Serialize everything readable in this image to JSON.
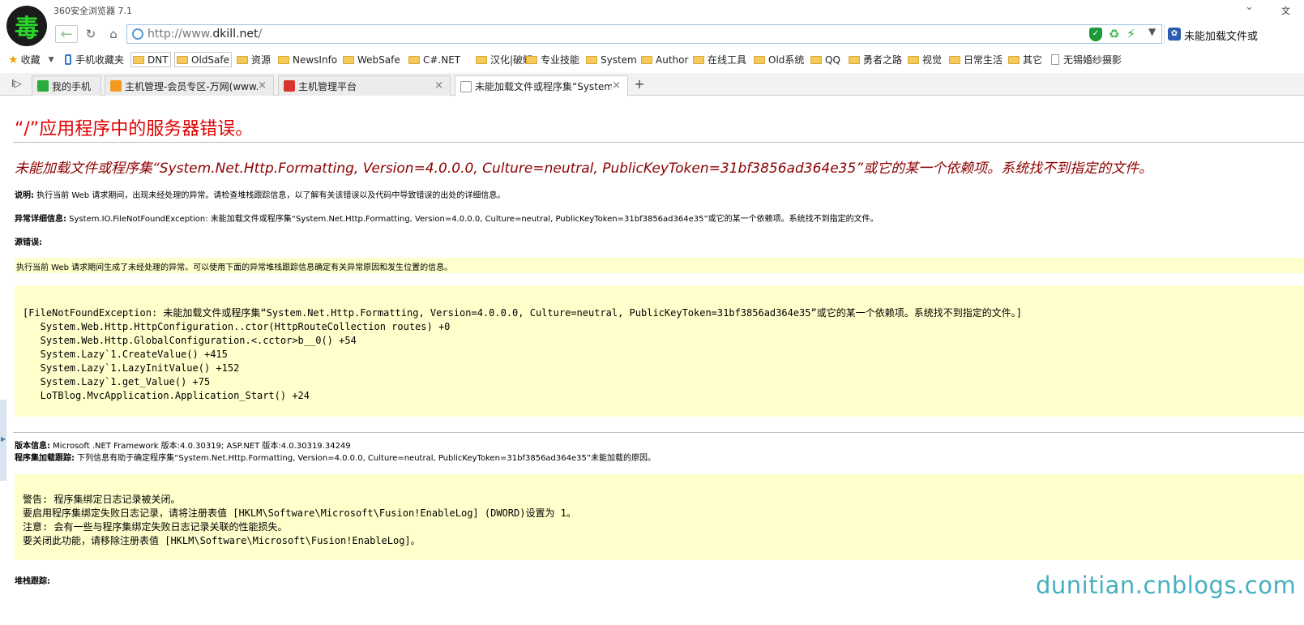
{
  "window": {
    "app_title": "360安全浏览器 7.1",
    "right_text": "文",
    "logo_char": "毒"
  },
  "addressbar": {
    "url_prefix": "http://www.",
    "url_domain": "dkill.net",
    "url_suffix": "/",
    "search_text": "未能加载文件或"
  },
  "bookmarks": [
    {
      "label": "收藏",
      "icon": "star-icon"
    },
    {
      "label": "手机收藏夹",
      "icon": "phone-icon"
    },
    {
      "label": "DNT",
      "icon": "folder-icon"
    },
    {
      "label": "OldSafe",
      "icon": "folder-icon"
    },
    {
      "label": "资源",
      "icon": "folder-icon"
    },
    {
      "label": "NewsInfo",
      "icon": "folder-icon"
    },
    {
      "label": "WebSafe",
      "icon": "folder-icon"
    },
    {
      "label": "C#.NET",
      "icon": "folder-icon"
    },
    {
      "label": "汉化|破解",
      "icon": "folder-icon"
    },
    {
      "label": "专业技能",
      "icon": "folder-icon"
    },
    {
      "label": "System",
      "icon": "folder-icon"
    },
    {
      "label": "Author",
      "icon": "folder-icon"
    },
    {
      "label": "在线工具",
      "icon": "folder-icon"
    },
    {
      "label": "Old系统",
      "icon": "folder-icon"
    },
    {
      "label": "QQ",
      "icon": "folder-icon"
    },
    {
      "label": "勇者之路",
      "icon": "folder-icon"
    },
    {
      "label": "视觉",
      "icon": "folder-icon"
    },
    {
      "label": "日常生活",
      "icon": "folder-icon"
    },
    {
      "label": "其它",
      "icon": "folder-icon"
    },
    {
      "label": "无锡婚纱摄影",
      "icon": "page-icon"
    }
  ],
  "tabs": [
    {
      "label": "我的手机",
      "color": "#2bab3a"
    },
    {
      "label": "主机管理-会员专区-万网(www.",
      "color": "#f39a1e"
    },
    {
      "label": "主机管理平台",
      "color": "#d9342b"
    },
    {
      "label": "未能加载文件或程序集“System",
      "color": "#ffffff"
    }
  ],
  "page": {
    "title": "“/”应用程序中的服务器错误。",
    "subtitle": "未能加载文件或程序集“System.Net.Http.Formatting, Version=4.0.0.0, Culture=neutral, PublicKeyToken=31bf3856ad364e35”或它的某一个依赖项。系统找不到指定的文件。",
    "desc_label": "说明:",
    "desc_text": " 执行当前 Web 请求期间，出现未经处理的异常。请检查堆栈跟踪信息，以了解有关该错误以及代码中导致错误的出处的详细信息。",
    "exception_label": "异常详细信息:",
    "exception_text": " System.IO.FileNotFoundException: 未能加载文件或程序集“System.Net.Http.Formatting, Version=4.0.0.0, Culture=neutral, PublicKeyToken=31bf3856ad364e35”或它的某一个依赖项。系统找不到指定的文件。",
    "source_error_label": "源错误:",
    "source_error_text": "执行当前 Web 请求期间生成了未经处理的异常。可以使用下面的异常堆栈跟踪信息确定有关异常原因和发生位置的信息。",
    "stack_trace": "[FileNotFoundException: 未能加载文件或程序集“System.Net.Http.Formatting, Version=4.0.0.0, Culture=neutral, PublicKeyToken=31bf3856ad364e35”或它的某一个依赖项。系统找不到指定的文件。]\n   System.Web.Http.HttpConfiguration..ctor(HttpRouteCollection routes) +0\n   System.Web.Http.GlobalConfiguration.<.cctor>b__0() +54\n   System.Lazy`1.CreateValue() +415\n   System.Lazy`1.LazyInitValue() +152\n   System.Lazy`1.get_Value() +75\n   LoTBlog.MvcApplication.Application_Start() +24",
    "version_label": "版本信息:",
    "version_text": " Microsoft .NET Framework 版本:4.0.30319; ASP.NET 版本:4.0.30319.34249",
    "assembly_label": "程序集加载跟踪:",
    "assembly_text": " 下列信息有助于确定程序集“System.Net.Http.Formatting, Version=4.0.0.0, Culture=neutral, PublicKeyToken=31bf3856ad364e35”未能加载的原因。",
    "warning_text": "警告: 程序集绑定日志记录被关闭。\n要启用程序集绑定失败日志记录，请将注册表值 [HKLM\\Software\\Microsoft\\Fusion!EnableLog] (DWORD)设置为 1。\n注意: 会有一些与程序集绑定失败日志记录关联的性能损失。\n要关闭此功能，请移除注册表值 [HKLM\\Software\\Microsoft\\Fusion!EnableLog]。",
    "stack_label": "堆栈跟踪:"
  },
  "watermark": "dunitian.cnblogs.com"
}
